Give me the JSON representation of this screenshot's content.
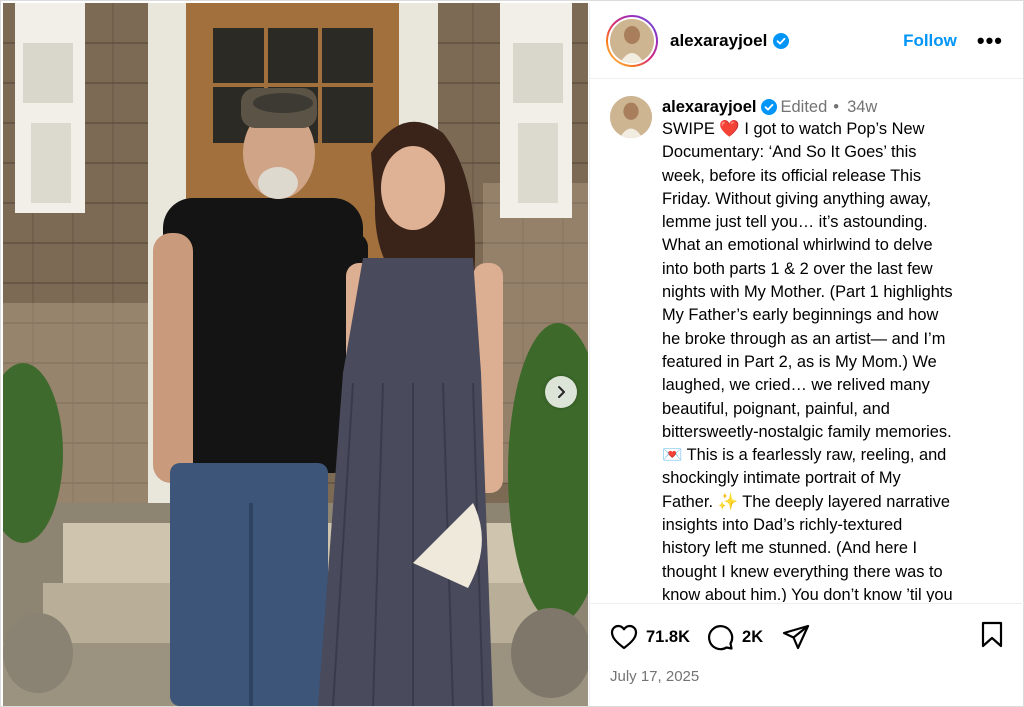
{
  "post": {
    "username": "alexarayjoel",
    "follow_label": "Follow",
    "more_label": "•••",
    "edited": "Edited",
    "dot": "•",
    "age": "34w",
    "caption_lines": [
      "SWIPE ❤️ I got to watch Pop’s New",
      "Documentary: ‘And So It Goes’ this",
      "week, before its official release This",
      "Friday. Without giving anything away,",
      "lemme just tell you… it’s astounding.",
      "What an emotional whirlwind to delve",
      "into both parts 1 & 2 over the last few",
      "nights with My Mother. (Part 1 highlights",
      "My Father’s early beginnings and how",
      "he broke through as an artist— and I’m",
      "featured in Part 2, as is My Mom.) We",
      "laughed, we cried… we relived many",
      "beautiful, poignant, painful, and",
      "bittersweetly-nostalgic family memories.",
      "💌 This is a fearlessly raw, reeling, and",
      "shockingly intimate portrait of My",
      "Father. ✨ The deeply layered narrative",
      "insights into Dad’s richly-textured",
      "history left me stunned. (And here I",
      "thought I knew everything there was to",
      "know about him.) You don’t know ’til you"
    ],
    "likes": "71.8K",
    "comments": "2K",
    "date": "July 17, 2025"
  },
  "colors": {
    "link": "#0095f6",
    "verified": "#0095f6",
    "muted": "#737373"
  },
  "icons": {
    "like": "heart-icon",
    "comment": "comment-icon",
    "share": "share-icon",
    "save": "bookmark-icon",
    "verified": "verified-badge-icon",
    "next": "chevron-right-icon"
  }
}
